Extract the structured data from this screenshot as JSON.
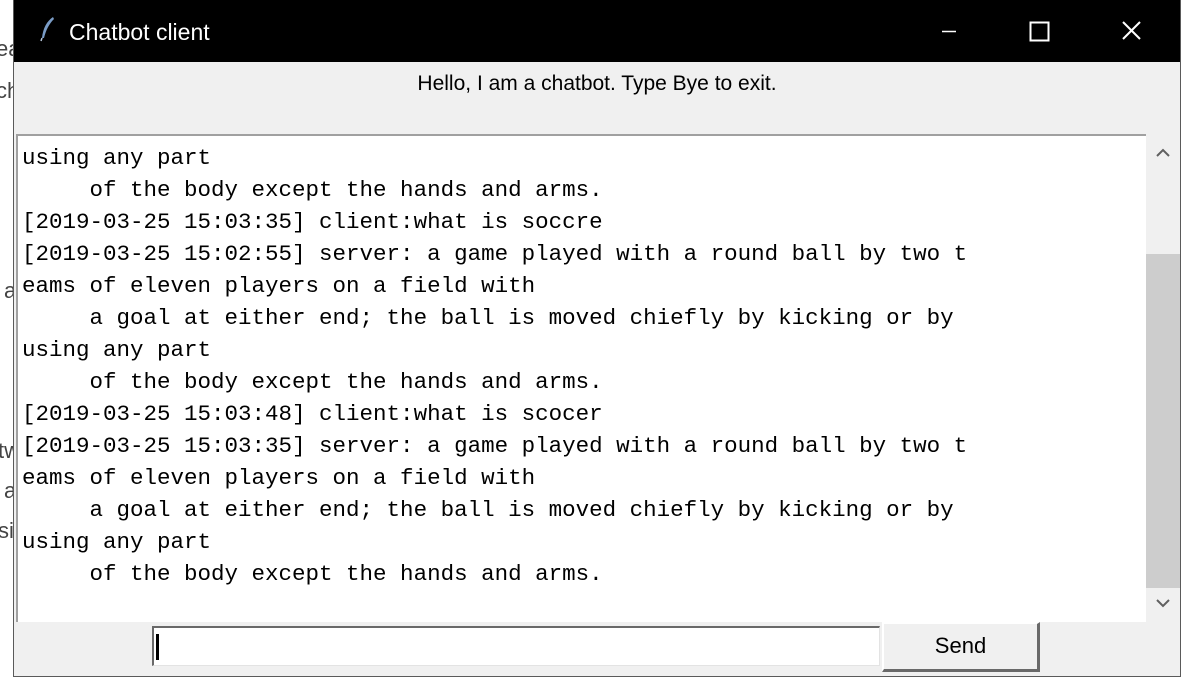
{
  "window": {
    "title": "Chatbot client",
    "controls": {
      "minimize_icon": "minimize-icon",
      "maximize_icon": "maximize-icon",
      "close_icon": "close-icon"
    }
  },
  "greeting": "Hello, I am a chatbot. Type Bye to exit.",
  "chat": {
    "lines": [
      "using any part",
      "     of the body except the hands and arms.",
      "[2019-03-25 15:03:35] client:what is soccre",
      "[2019-03-25 15:02:55] server: a game played with a round ball by two t",
      "eams of eleven players on a field with",
      "     a goal at either end; the ball is moved chiefly by kicking or by",
      "using any part",
      "     of the body except the hands and arms.",
      "[2019-03-25 15:03:48] client:what is scocer",
      "[2019-03-25 15:03:35] server: a game played with a round ball by two t",
      "eams of eleven players on a field with",
      "     a goal at either end; the ball is moved chiefly by kicking or by",
      "using any part",
      "     of the body except the hands and arms."
    ]
  },
  "input": {
    "value": ""
  },
  "send_label": "Send",
  "colors": {
    "titlebar": "#000000",
    "window_bg": "#f0f0f0",
    "chat_bg": "#ffffff",
    "scroll_thumb": "#cdcdcd"
  }
}
